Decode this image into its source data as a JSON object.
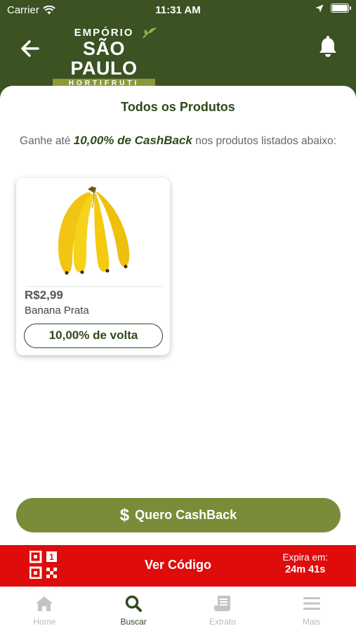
{
  "status_bar": {
    "carrier": "Carrier",
    "time": "11:31 AM"
  },
  "brand": {
    "line1": "EMPÓRIO",
    "line2": "SÃO PAULO",
    "line3": "HORTIFRUTI"
  },
  "page": {
    "title": "Todos os Produtos",
    "subtitle_prefix": "Ganhe até ",
    "subtitle_highlight": "10,00% de CashBack",
    "subtitle_suffix": " nos produtos listados abaixo:"
  },
  "products": [
    {
      "price": "R$2,99",
      "name": "Banana Prata",
      "cashback": "10,00% de volta"
    }
  ],
  "cta": {
    "label": "Quero CashBack"
  },
  "code_bar": {
    "label": "Ver Código",
    "expires_label": "Expira em:",
    "expires_value": "24m 41s"
  },
  "tabs": [
    {
      "label": "Home",
      "icon": "home-icon"
    },
    {
      "label": "Buscar",
      "icon": "search-icon",
      "active": true
    },
    {
      "label": "Extrato",
      "icon": "receipt-icon"
    },
    {
      "label": "Mais",
      "icon": "menu-icon"
    }
  ],
  "colors": {
    "brand_green": "#3b5222",
    "accent_olive": "#7b8c38",
    "alert_red": "#e00b0b",
    "text_green": "#2f4a1a"
  }
}
